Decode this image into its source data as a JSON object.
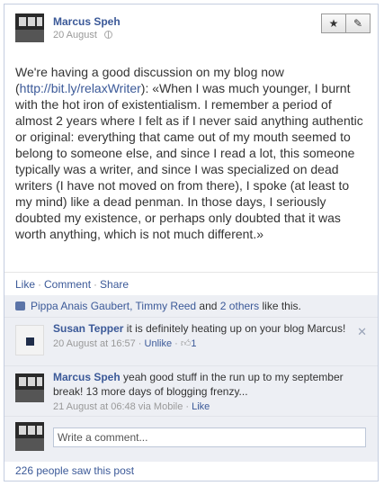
{
  "post": {
    "author": "Marcus Speh",
    "date": "20 August",
    "text_before_link": "We're having a good discussion on my blog now\n(",
    "link_text": "http://bit.ly/relaxWriter",
    "text_after_link": "): «When I was much younger, I burnt with the hot iron of existentialism. I remember a period of almost 2 years where I felt as if I never said anything authentic or original: everything that came out of my mouth seemed to belong to someone else, and since I read a lot, this someone typically was a writer, and since I was specialized on dead writers (I have not moved on from there), I spoke (at least to my mind) like a dead penman. In those days, I seriously doubted my existence, or perhaps only doubted that it was worth anything, which is not much different.»"
  },
  "actions": {
    "like": "Like",
    "comment": "Comment",
    "share": "Share",
    "separator": "·"
  },
  "likes": {
    "names": "Pippa Anais Gaubert, Timmy Reed",
    "and": " and ",
    "others": "2 others",
    "suffix": " like this."
  },
  "comments": [
    {
      "author": "Susan Tepper",
      "text": " it is definitely heating up on your blog Marcus!",
      "time": "20 August at 16:57",
      "action": "Unlike",
      "like_count": "1",
      "close": "✕"
    },
    {
      "author": "Marcus Speh",
      "text": " yeah good stuff in the run up to my september break! 13 more days of blogging frenzy...",
      "time": "21 August at 06:48 via Mobile",
      "action": "Like"
    }
  ],
  "compose": {
    "placeholder": "Write a comment..."
  },
  "seen": "226 people saw this post",
  "icons": {
    "star": "★",
    "pencil": "✎",
    "thumb": "thumbs-up-icon"
  }
}
